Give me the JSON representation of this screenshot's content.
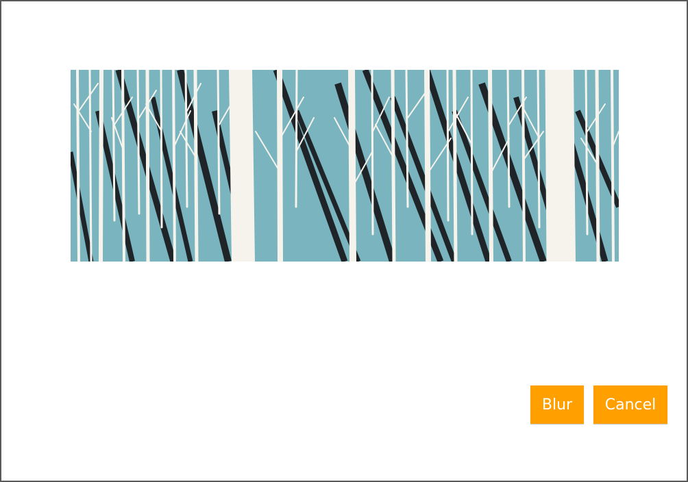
{
  "image": {
    "subject": "forest-illustration-icon"
  },
  "actions": {
    "blur_label": "Blur",
    "cancel_label": "Cancel"
  },
  "colors": {
    "accent": "#ffa000",
    "sky": "#7ab4bf",
    "trunk": "#f5f3ec",
    "shadow": "#1f2428",
    "border": "#5a5a5a"
  }
}
